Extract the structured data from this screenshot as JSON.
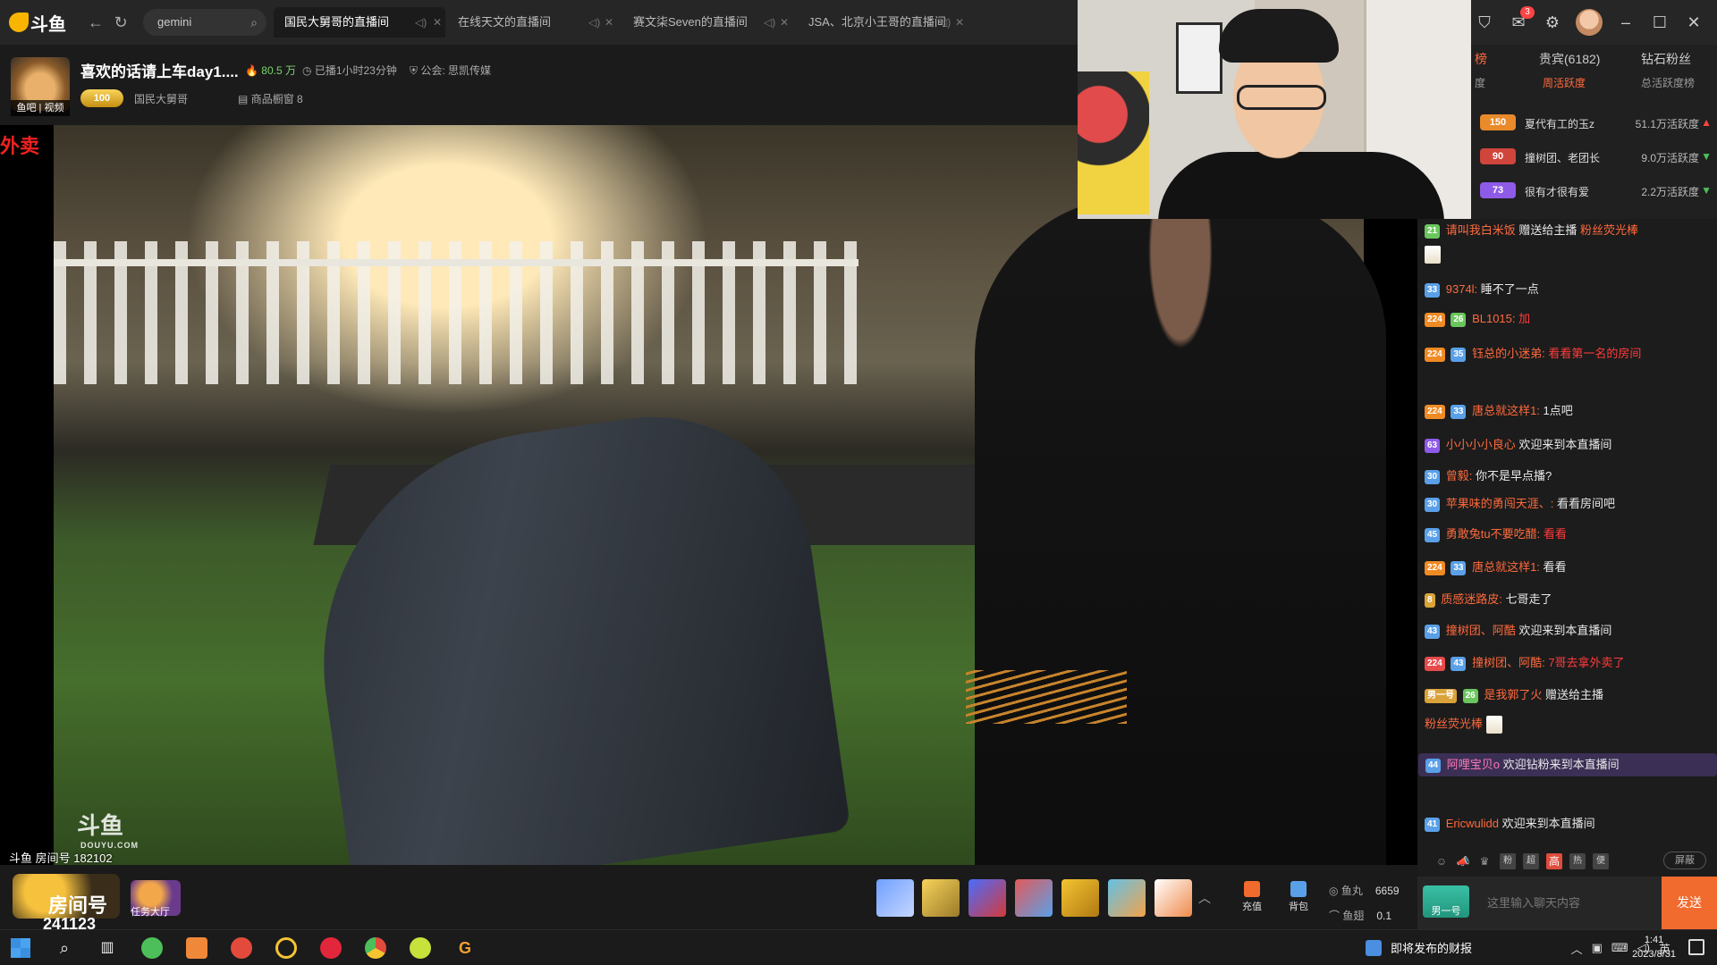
{
  "app": {
    "logo_text": "斗鱼",
    "search_value": "gemini"
  },
  "tabs": [
    {
      "label": "国民大舅哥的直播间",
      "active": true
    },
    {
      "label": "在线天文的直播间",
      "active": false
    },
    {
      "label": "赛文柒Seven的直播间",
      "active": false
    },
    {
      "label": "JSA、北京小王哥的直播间",
      "active": false
    }
  ],
  "window": {
    "notification_count": "3"
  },
  "room": {
    "title": "喜欢的话请上车day1....",
    "popularity": "80.5 万",
    "live_duration": "已播1小时23分钟",
    "guild": "公会: 思凯传媒",
    "anchor_name": "国民大舅哥",
    "level_badge": "100",
    "goods": "商品橱窗 8",
    "avatar_caption": "鱼吧 | 视频",
    "overlay_text": "外卖",
    "room_number": "斗鱼 房间号 182102",
    "watermark": "斗鱼",
    "watermark_sub": "DOUYU.COM"
  },
  "rank": {
    "tabs": [
      "榜",
      "贵宾(6182)",
      "钻石粉丝"
    ],
    "subtabs": [
      "度",
      "周活跃度",
      "总活跃度榜"
    ],
    "rows": [
      {
        "badge": "150",
        "badge_color": "#e98a2b",
        "name": "夏代有工的玉z",
        "value": "51.1万活跃度",
        "trend": "up"
      },
      {
        "badge": "90",
        "badge_color": "#d0453b",
        "name": "撞树团、老团长",
        "value": "9.0万活跃度",
        "trend": "down"
      },
      {
        "badge": "73",
        "badge_color": "#8e5be8",
        "name": "很有才很有爱",
        "value": "2.2万活跃度",
        "trend": "down"
      }
    ]
  },
  "chat": {
    "messages": [
      {
        "chips": [
          "21"
        ],
        "user": "请叫我白米饭",
        "text": "赠送给主播",
        "extra": "粉丝荧光棒"
      },
      {
        "chips": [
          "33"
        ],
        "user": "9374l:",
        "text": "睡不了一点"
      },
      {
        "chips": [
          "224",
          "26"
        ],
        "user": "BL1015:",
        "text": "加",
        "hot": true
      },
      {
        "chips": [
          "224",
          "35"
        ],
        "user": "钰总的小迷弟:",
        "text": "看看第一名的房间",
        "hot": true
      },
      {
        "chips": [
          "224",
          "33"
        ],
        "user": "唐总就这样1:",
        "text": "1点吧"
      },
      {
        "chips": [
          "63"
        ],
        "user": "小小小小良心",
        "text": "欢迎来到本直播间"
      },
      {
        "chips": [
          "30"
        ],
        "user": "曾毅:",
        "text": "你不是早点播?"
      },
      {
        "chips": [
          "30"
        ],
        "user": "苹果味的勇闯天涯、:",
        "text": "看看房间吧"
      },
      {
        "chips": [
          "45"
        ],
        "user": "勇敢兔tu不要吃醋:",
        "text": "看看",
        "hot": true
      },
      {
        "chips": [
          "224",
          "33"
        ],
        "user": "唐总就这样1:",
        "text": "看看"
      },
      {
        "chips": [
          "8"
        ],
        "user": "质感迷路皮:",
        "text": "七哥走了"
      },
      {
        "chips": [
          "43"
        ],
        "user": "撞树团、阿酷",
        "text": "欢迎来到本直播间"
      },
      {
        "chips": [
          "224",
          "43"
        ],
        "user": "撞树团、阿酷:",
        "text": "7哥去拿外卖了",
        "hot": true
      },
      {
        "chips": [
          "男一号",
          "26"
        ],
        "user": "是我郭了火",
        "text": "赠送给主播",
        "extra": "粉丝荧光棒"
      },
      {
        "chips": [
          "44"
        ],
        "user": "阿哩宝贝o",
        "text": "欢迎钻粉来到本直播间",
        "highlight": true
      },
      {
        "chips": [
          "41"
        ],
        "user": "Ericwulidd",
        "text": "欢迎来到本直播间"
      }
    ],
    "tool_labels": [
      "粉",
      "超",
      "高",
      "热",
      "便"
    ],
    "shield_label": "屏蔽",
    "fans_badge": "男一号",
    "input_placeholder": "这里输入聊天内容",
    "send_label": "发送"
  },
  "bottom": {
    "fangjian_label": "房间号",
    "room_count": "241123",
    "task_label": "任务大厅",
    "recharge_label": "充值",
    "backpack_label": "背包",
    "yuwan_label": "鱼丸",
    "yuwan_value": "6659",
    "yuchi_label": "鱼翅",
    "yuchi_value": "0.1"
  },
  "taskbar": {
    "news": "即将发布的财报",
    "ime": "英",
    "time": "1:41",
    "date": "2023/8/31"
  },
  "colors": {
    "accent": "#ff6a3c",
    "send": "#f26b2e",
    "hot": "#78d36b"
  }
}
